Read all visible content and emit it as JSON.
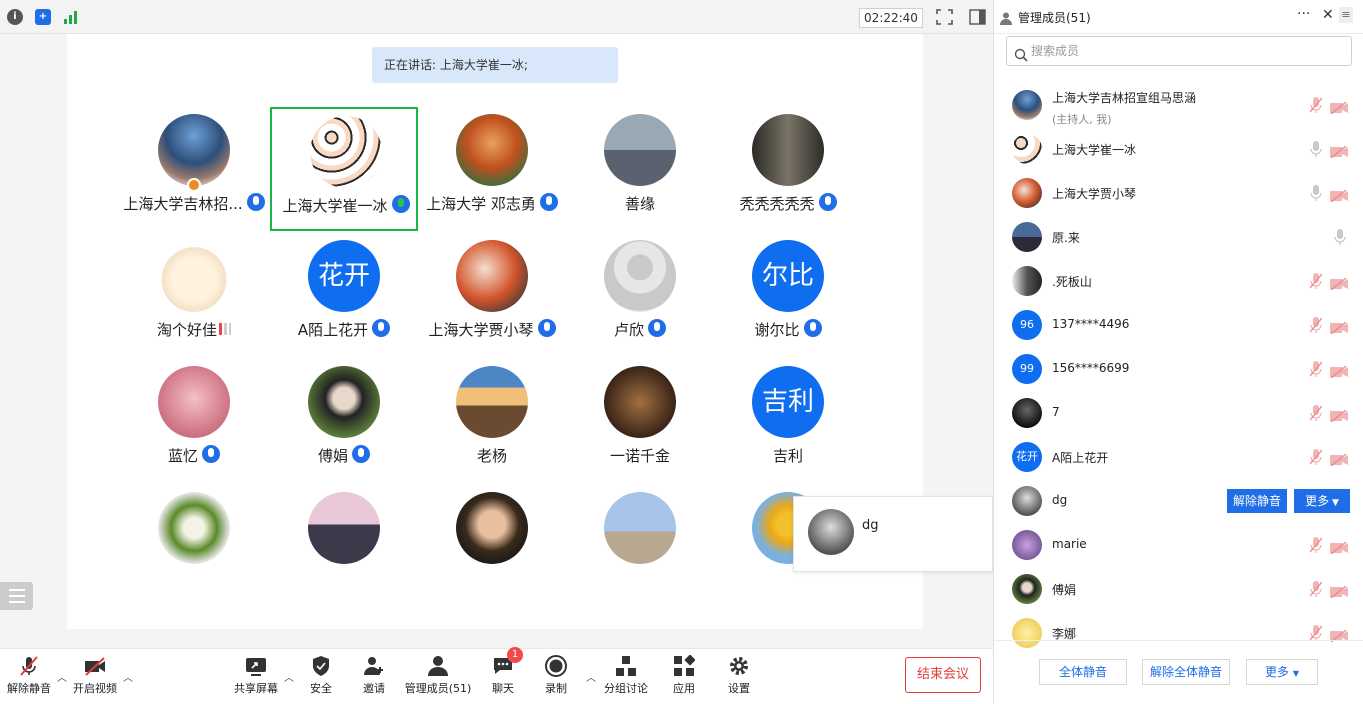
{
  "topbar": {
    "timer": "02:22:40",
    "icons": [
      "info-icon",
      "shield-icon",
      "signal-icon",
      "fullscreen-icon",
      "layout-icon"
    ]
  },
  "speaking": "正在讲话: 上海大学崔一冰;",
  "grid": [
    {
      "name": "上海大学吉林招...",
      "mic": "blue",
      "avatar": "photo-building"
    },
    {
      "name": "上海大学崔一冰",
      "mic": "green",
      "avatar": "photo-faces",
      "active": true
    },
    {
      "name": "上海大学 邓志勇",
      "mic": "blue",
      "avatar": "photo-tree"
    },
    {
      "name": "善缘",
      "mic": "",
      "avatar": "photo-lake"
    },
    {
      "name": "秃秃秃秃秃",
      "mic": "blue",
      "avatar": "photo-street"
    },
    {
      "name": "淘个好佳",
      "mic": "signal",
      "avatar": "photo-bear"
    },
    {
      "name": "A陌上花开",
      "mic": "blue",
      "avatar": "text",
      "text": "花开"
    },
    {
      "name": "上海大学贾小琴",
      "mic": "blue",
      "avatar": "photo-leaves"
    },
    {
      "name": "卢欣",
      "mic": "blue",
      "avatar": "default-person"
    },
    {
      "name": "谢尔比",
      "mic": "blue",
      "avatar": "text",
      "text": "尔比"
    },
    {
      "name": "蓝忆",
      "mic": "blue",
      "avatar": "photo-pink"
    },
    {
      "name": "傅娟",
      "mic": "blue",
      "avatar": "photo-girl"
    },
    {
      "name": "老杨",
      "mic": "",
      "avatar": "photo-mountain"
    },
    {
      "name": "一诺千金",
      "mic": "",
      "avatar": "photo-room"
    },
    {
      "name": "吉利",
      "mic": "",
      "avatar": "text",
      "text": "吉利"
    },
    {
      "name": "",
      "mic": "",
      "avatar": "photo-flower"
    },
    {
      "name": "",
      "mic": "",
      "avatar": "photo-sunset"
    },
    {
      "name": "",
      "mic": "",
      "avatar": "photo-man"
    },
    {
      "name": "",
      "mic": "",
      "avatar": "photo-arch"
    },
    {
      "name": "",
      "mic": "",
      "avatar": "photo-sunflower"
    }
  ],
  "popup": {
    "name": "dg"
  },
  "toolbar": {
    "unmute": "解除静音",
    "video": "开启视频",
    "share": "共享屏幕",
    "security": "安全",
    "invite": "邀请",
    "members": "管理成员(51)",
    "chat": "聊天",
    "chat_badge": "1",
    "record": "录制",
    "breakout": "分组讨论",
    "apps": "应用",
    "settings": "设置",
    "end": "结束会议"
  },
  "panel": {
    "title": "管理成员(51)",
    "search_placeholder": "搜索成员",
    "members": [
      {
        "name": "上海大学吉林招宣组马思涵",
        "sub": "(主持人, 我)",
        "avatar": "photo-building",
        "mic": "muted",
        "cam": "off"
      },
      {
        "name": "上海大学崔一冰",
        "sub": "",
        "avatar": "photo-faces",
        "mic": "on-gray",
        "cam": "off"
      },
      {
        "name": "上海大学贾小琴",
        "sub": "",
        "avatar": "photo-leaves",
        "mic": "on-gray",
        "cam": "off"
      },
      {
        "name": "原.来",
        "sub": "",
        "avatar": "photo-dusk",
        "mic": "on-gray",
        "cam": ""
      },
      {
        "name": ".死板山",
        "sub": "",
        "avatar": "photo-cat",
        "mic": "muted",
        "cam": "off"
      },
      {
        "name": "137****4496",
        "sub": "",
        "avatar": "text",
        "text": "96",
        "mic": "muted",
        "cam": "off"
      },
      {
        "name": "156****6699",
        "sub": "",
        "avatar": "text",
        "text": "99",
        "mic": "muted",
        "cam": "off"
      },
      {
        "name": "7",
        "sub": "",
        "avatar": "photo-dark",
        "mic": "muted",
        "cam": "off"
      },
      {
        "name": "A陌上花开",
        "sub": "",
        "avatar": "text",
        "text": "花开",
        "mic": "muted",
        "cam": "off"
      },
      {
        "name": "dg",
        "sub": "",
        "avatar": "photo-gray",
        "mic": "",
        "cam": "",
        "actions": true
      },
      {
        "name": "marie",
        "sub": "",
        "avatar": "photo-purple",
        "mic": "muted",
        "cam": "off"
      },
      {
        "name": "傅娟",
        "sub": "",
        "avatar": "photo-girl",
        "mic": "muted",
        "cam": "off"
      },
      {
        "name": "李娜",
        "sub": "",
        "avatar": "photo-chick",
        "mic": "muted",
        "cam": "off"
      }
    ],
    "dg_unmute": "解除静音",
    "dg_more": "更多",
    "mute_all": "全体静音",
    "unmute_all": "解除全体静音",
    "more": "更多"
  }
}
